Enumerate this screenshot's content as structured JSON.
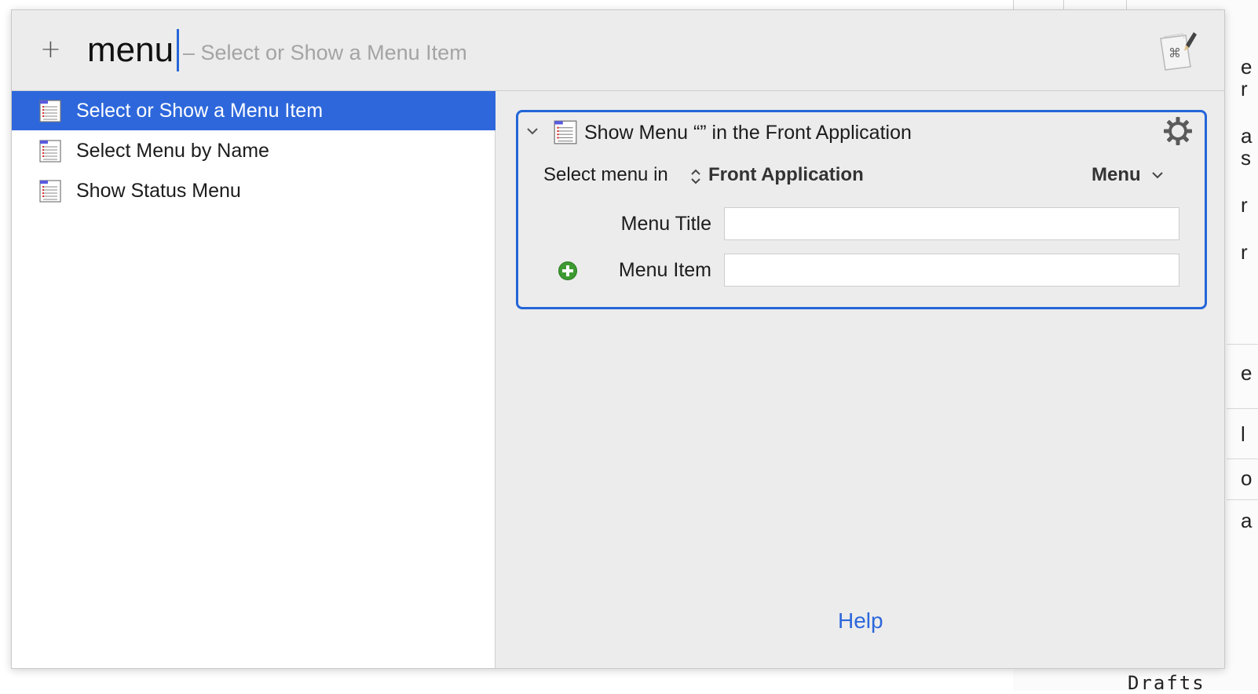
{
  "search": {
    "plus_glyph": "+",
    "query": "menu",
    "hint": "– Select or Show a Menu Item"
  },
  "app_icon": "keyboard-maestro-icon",
  "list": {
    "items": [
      {
        "label": "Select or Show a Menu Item",
        "selected": true,
        "icon": "menu-list-icon"
      },
      {
        "label": "Select Menu by Name",
        "selected": false,
        "icon": "menu-list-icon"
      },
      {
        "label": "Show Status Menu",
        "selected": false,
        "icon": "menu-list-icon"
      }
    ]
  },
  "action": {
    "title": "Show Menu “” in the Front Application",
    "select_menu_in": "Select menu in",
    "target": "Front Application",
    "menu_dropdown": "Menu",
    "menu_title_label": "Menu Title",
    "menu_title_value": "",
    "menu_item_label": "Menu Item",
    "menu_item_value": ""
  },
  "help": "Help",
  "background": {
    "bottom_text": "Drafts",
    "edge_glyphs": [
      "e",
      "r",
      "a",
      "s",
      "r",
      "r",
      "e",
      "l",
      "o",
      "a"
    ]
  },
  "colors": {
    "selection": "#2d67db",
    "accent": "#2466d9",
    "add_green": "#3d9a32"
  }
}
